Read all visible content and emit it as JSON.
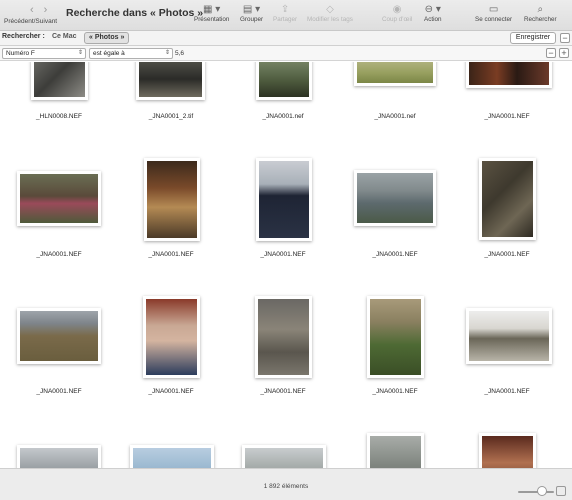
{
  "toolbar": {
    "back_icon": "chevron-left-icon",
    "forward_icon": "chevron-right-icon",
    "nav_label": "Précédent/Suivant",
    "title": "Recherche dans « Photos »",
    "presentation": "Présentation",
    "group": "Grouper",
    "share": "Partager",
    "tags": "Modifier les tags",
    "quicklook": "Coup d'œil",
    "action": "Action",
    "connect": "Se connecter",
    "search": "Rechercher"
  },
  "scope": {
    "label": "Rechercher :",
    "this_mac": "Ce Mac",
    "photos": "« Photos »",
    "save": "Enregistrer",
    "remove": "−"
  },
  "criteria": {
    "attribute": "Numéro F",
    "operator": "est égale à",
    "value": "5,6",
    "remove": "−",
    "add": "+"
  },
  "files": [
    [
      "_HLN0008.NEF",
      "_JNA0001_2.tif",
      "_JNA0001.nef",
      "_JNA0001.nef",
      "_JNA0001.NEF"
    ],
    [
      "_JNA0001.NEF",
      "_JNA0001.NEF",
      "_JNA0001.NEF",
      "_JNA0001.NEF",
      "_JNA0001.NEF"
    ],
    [
      "_JNA0001.NEF",
      "_JNA0001.NEF",
      "_JNA0001.NEF",
      "_JNA0001.NEF",
      "_JNA0001.NEF"
    ],
    [
      "",
      "",
      "",
      "",
      ""
    ]
  ],
  "status": {
    "count": "1 892 éléments"
  }
}
